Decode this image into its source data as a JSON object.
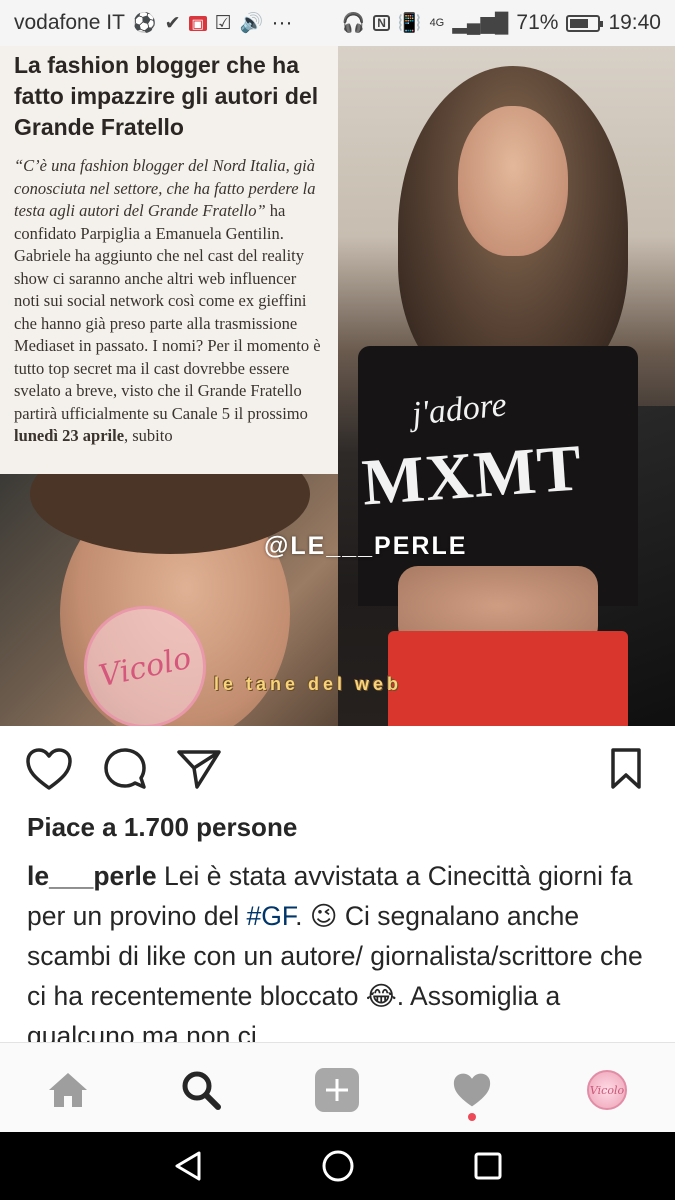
{
  "status_bar": {
    "carrier": "vodafone IT",
    "more": "···",
    "network": "4G",
    "battery": "71%",
    "battery_level": 0.71,
    "time": "19:40"
  },
  "post": {
    "article": {
      "title": "La fashion blogger che ha fatto impazzire gli autori del Grande Fratello",
      "quote": "“C’è una fashion blogger del Nord Italia, già conosciuta nel settore, che ha fatto perdere la testa agli autori del Grande Fratello”",
      "body_1": " ha confidato Parpiglia a Emanuela Gentilin. Gabriele ha aggiunto che nel cast del reality show ci saranno anche altri web influencer noti sui social network così come ex gieffini che hanno già preso parte alla trasmissione Mediaset in passato. I nomi? Per il momento è tutto top secret ma il cast dovrebbe essere svelato a breve, visto che il Grande Fratello partirà ufficialmente su Canale 5 il prossimo ",
      "date": "lunedì 23 aprile",
      "body_2": ", subito"
    },
    "shirt_line_1": "j'adore",
    "shirt_line_2": "MXMT",
    "watermark": "@LE___PERLE",
    "stamp": "Vicolo",
    "sticker": "le tane del web"
  },
  "likes": "Piace a 1.700 persone",
  "caption": {
    "username": "le___perle",
    "text_1": " Lei è stata avvistata a Cinecittà giorni fa per un provino del ",
    "hashtag": "#GF",
    "text_2": ". 😉 Ci segnalano anche scambi di like con un autore/ giornalista/scrittore che ci ha recentemente bloccato 😂. Assomiglia a qualcuno ma non ci"
  },
  "colors": {
    "hashtag": "#003569",
    "notification": "#ed4956",
    "text": "#262626"
  },
  "bottom_nav": {
    "profile_label": "Vicolo"
  }
}
